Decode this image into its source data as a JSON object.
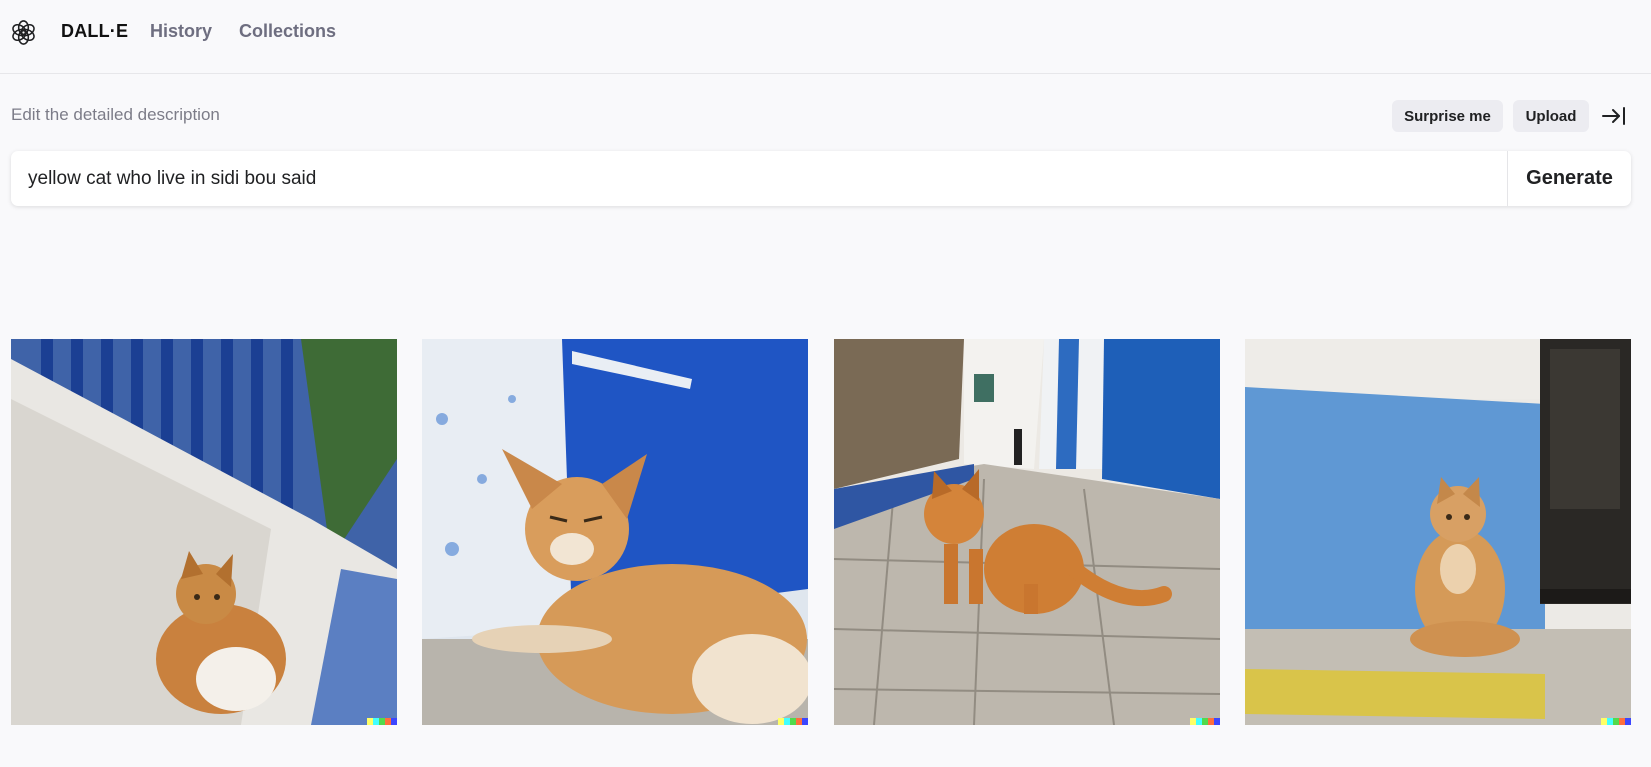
{
  "header": {
    "logo_icon": "openai-logo-icon",
    "brand": "DALL·E",
    "nav": [
      {
        "label": "History"
      },
      {
        "label": "Collections"
      }
    ]
  },
  "editor": {
    "description_label": "Edit the detailed description",
    "surprise_label": "Surprise me",
    "upload_label": "Upload",
    "collapse_icon": "arrow-right-to-bar-icon",
    "prompt_value": "yellow cat who live in sidi bou said",
    "generate_label": "Generate"
  },
  "results": {
    "images": [
      {
        "subject": "orange and white cat lying beside a white wall under a blue window grille"
      },
      {
        "subject": "orange tabby cat lounging in front of a blue door and white wall"
      },
      {
        "subject": "orange tabby cat standing on a stone-paved alley with blue doors"
      },
      {
        "subject": "orange cat sitting against a blue painted wall next to a dark door"
      }
    ],
    "signature_colors": [
      "#ffff66",
      "#42ffff",
      "#51da4c",
      "#ff6e3c",
      "#3c46ff"
    ]
  },
  "colors": {
    "background": "#f9f9fb",
    "brand_text": "#111111",
    "nav_text": "#6e6e80",
    "pill_bg": "#ececf1"
  }
}
